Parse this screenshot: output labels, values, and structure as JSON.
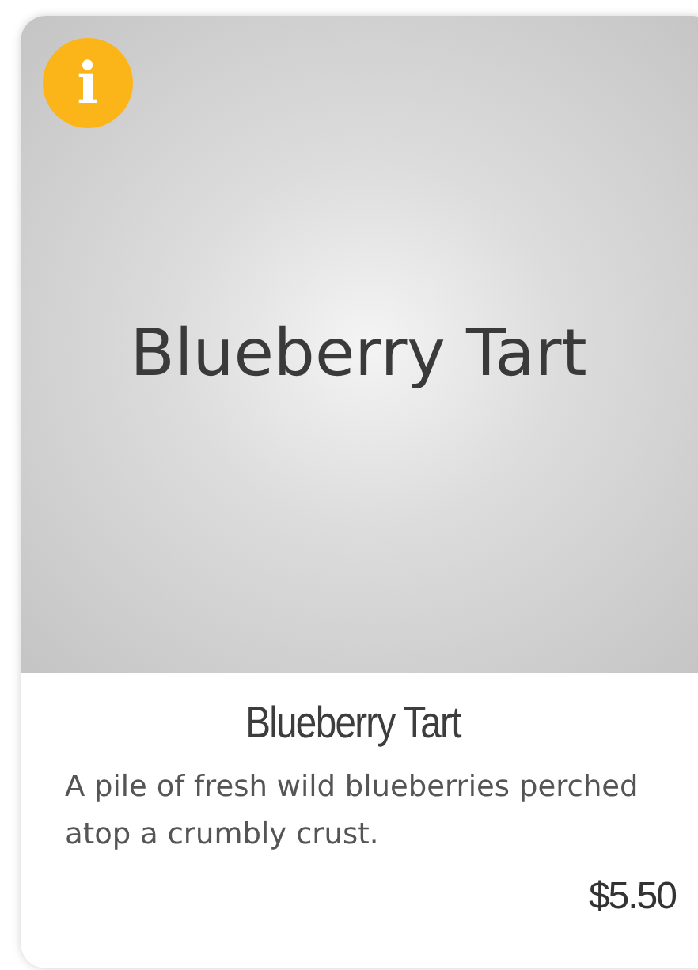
{
  "card": {
    "image_text": "Blueberry Tart",
    "info_badge": "i",
    "title": "Blueberry Tart",
    "description": "A pile of fresh wild blueberries perched atop a crumbly crust.",
    "price": "$5.50"
  }
}
